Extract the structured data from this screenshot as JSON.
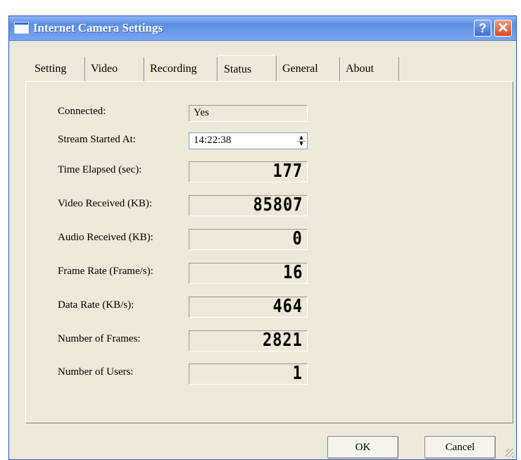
{
  "window": {
    "title": "Internet Camera Settings",
    "help_button": "?",
    "close_button": "✕"
  },
  "tabs": [
    {
      "label": "Setting",
      "active": false
    },
    {
      "label": "Video",
      "active": false
    },
    {
      "label": "Recording",
      "active": false
    },
    {
      "label": "Status",
      "active": true
    },
    {
      "label": "General",
      "active": false
    },
    {
      "label": "About",
      "active": false
    }
  ],
  "status": {
    "connected": {
      "label": "Connected:",
      "value": "Yes"
    },
    "stream_started": {
      "label": "Stream Started At:",
      "value": "14:22:38"
    },
    "time_elapsed": {
      "label": "Time Elapsed (sec):",
      "value": "177"
    },
    "video_received": {
      "label": "Video Received (KB):",
      "value": "85807"
    },
    "audio_received": {
      "label": "Audio Received (KB):",
      "value": "0"
    },
    "frame_rate": {
      "label": "Frame Rate (Frame/s):",
      "value": "16"
    },
    "data_rate": {
      "label": "Data Rate (KB/s):",
      "value": "464"
    },
    "num_frames": {
      "label": "Number of Frames:",
      "value": "2821"
    },
    "num_users": {
      "label": "Number of Users:",
      "value": "1"
    }
  },
  "buttons": {
    "ok": "OK",
    "cancel": "Cancel"
  },
  "colors": {
    "titlebar": "#5a8fe6",
    "dialog_bg": "#ece9d8",
    "close_button": "#d84a22"
  }
}
